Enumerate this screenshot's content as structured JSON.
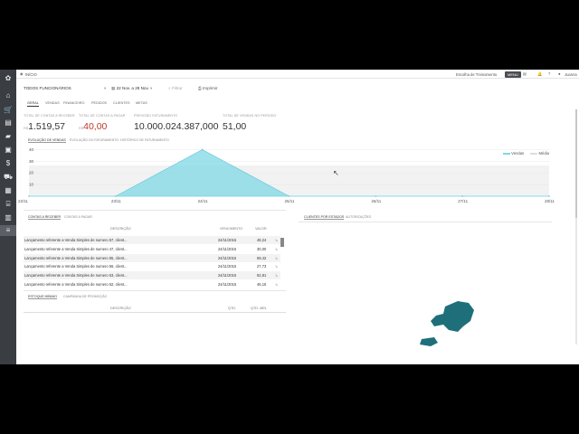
{
  "topbar": {
    "title": "INÍCIO",
    "right_link": "Escolha de Treinamento",
    "right_button": "MENU",
    "user": "Juanna"
  },
  "filters": {
    "employee": "TODOS FUNCIONÁRIOS",
    "date_range": "22 Nov. a 28 Nov.",
    "filter_label": "Filtrar",
    "print_label": "Imprimir"
  },
  "main_tabs": [
    "GERAL",
    "VENDAS",
    "FINANCEIRO",
    "PEDIDOS",
    "CLIENTES",
    "METAS"
  ],
  "kpis": [
    {
      "label": "TOTAL DE CONTAS A RECEBER",
      "currency": "R$",
      "value": "1.519,57",
      "color": "#333"
    },
    {
      "label": "TOTAL DE CONTAS A PAGAR",
      "currency": "R$",
      "value": "40,00",
      "color": "#c0392b"
    },
    {
      "label": "PREVISÃO FATURAMENTO",
      "currency": "",
      "value": "10.000.024.387,000",
      "color": "#333"
    },
    {
      "label": "TOTAL DE VENDAS NO PERÍODO",
      "currency": "",
      "value": "51,00",
      "color": "#333"
    }
  ],
  "chart_tabs": [
    "EVOLUÇÃO DE VENDAS",
    "EVOLUÇÃO DO FATURAMENTO",
    "HISTÓRICO DE FATURAMENTO"
  ],
  "chart_data": {
    "type": "area",
    "x": [
      "22/11",
      "23/11",
      "24/11",
      "25/11",
      "26/11",
      "27/11",
      "28/11"
    ],
    "series": [
      {
        "name": "Vendas",
        "values": [
          0,
          0,
          40,
          0,
          0,
          0,
          0
        ],
        "color": "#7fd8e6"
      },
      {
        "name": "Média",
        "values": [
          0,
          0,
          0,
          0,
          0,
          0,
          0
        ],
        "color": "#dddddd"
      }
    ],
    "yticks": [
      10,
      20,
      30,
      40
    ],
    "ylim": [
      0,
      45
    ],
    "legend": "top-right"
  },
  "receivables": {
    "tabs": [
      "CONTAS A RECEBER",
      "CONTAS A PAGAR"
    ],
    "headers": [
      "DESCRIÇÃO",
      "VENCIMENTO",
      "VALOR"
    ],
    "rows": [
      {
        "desc": "Lançamento referente a Venda Simples de numero 57, client...",
        "due": "24/11/2015",
        "value": "48,24"
      },
      {
        "desc": "Lançamento referente a Venda Simples de numero 47, client...",
        "due": "24/11/2015",
        "value": "30,00"
      },
      {
        "desc": "Lançamento referente a Venda Simples de numero 55, client...",
        "due": "24/11/2015",
        "value": "69,42"
      },
      {
        "desc": "Lançamento referente a Venda Simples de numero 56, client...",
        "due": "24/11/2015",
        "value": "27,73"
      },
      {
        "desc": "Lançamento referente a Venda Simples de numero 53, client...",
        "due": "24/11/2015",
        "value": "52,81"
      },
      {
        "desc": "Lançamento referente a Venda Simples de numero 52, client...",
        "due": "24/11/2015",
        "value": "46,16"
      }
    ]
  },
  "stock": {
    "tabs": [
      "ESTOQUE MÍNIMO",
      "CAMPANHA DE PROMOÇÃO"
    ],
    "headers": [
      "DESCRIÇÃO",
      "QTD.",
      "QTD. MÍN."
    ]
  },
  "map_panel": {
    "tabs": [
      "CLIENTES POR ESTADOS",
      "AUTORIZAÇÕES"
    ],
    "fill_color": "#1f6f7a"
  }
}
